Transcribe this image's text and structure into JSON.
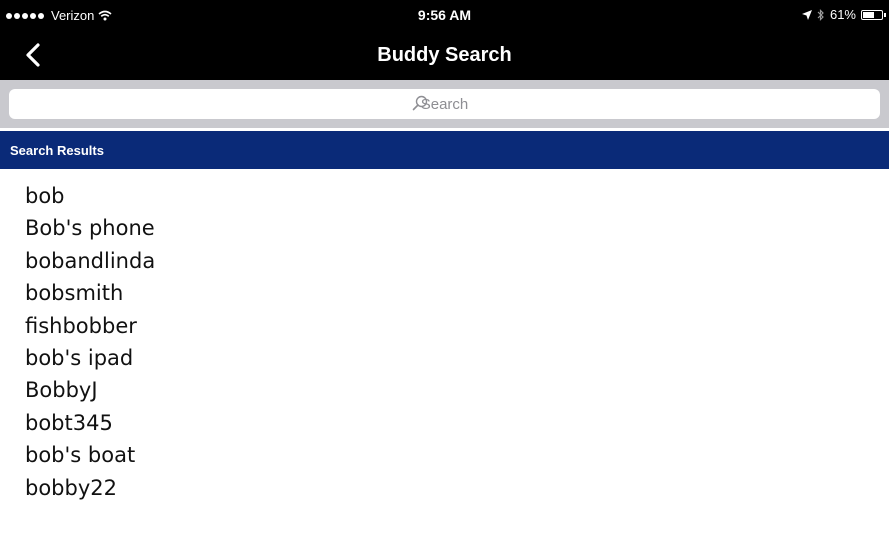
{
  "status_bar": {
    "carrier": "Verizon",
    "time": "9:56 AM",
    "battery_percent": "61%",
    "battery_level": 0.61,
    "icons": [
      "signal-dots-icon",
      "wifi-icon",
      "location-arrow-icon",
      "bluetooth-icon",
      "battery-icon"
    ]
  },
  "nav": {
    "title": "Buddy Search",
    "back_icon": "chevron-left-icon"
  },
  "search": {
    "placeholder": "Search",
    "icon": "search-icon"
  },
  "section": {
    "header": "Search Results"
  },
  "results": [
    "bob",
    "Bob's phone",
    "bobandlinda",
    "bobsmith",
    "fishbobber",
    "bob's ipad",
    "BobbyJ",
    "bobt345",
    "bob's boat",
    "bobby22"
  ],
  "colors": {
    "nav_background": "#000000",
    "section_header": "#0a2a78",
    "search_bar_background": "#c9c9ce"
  }
}
